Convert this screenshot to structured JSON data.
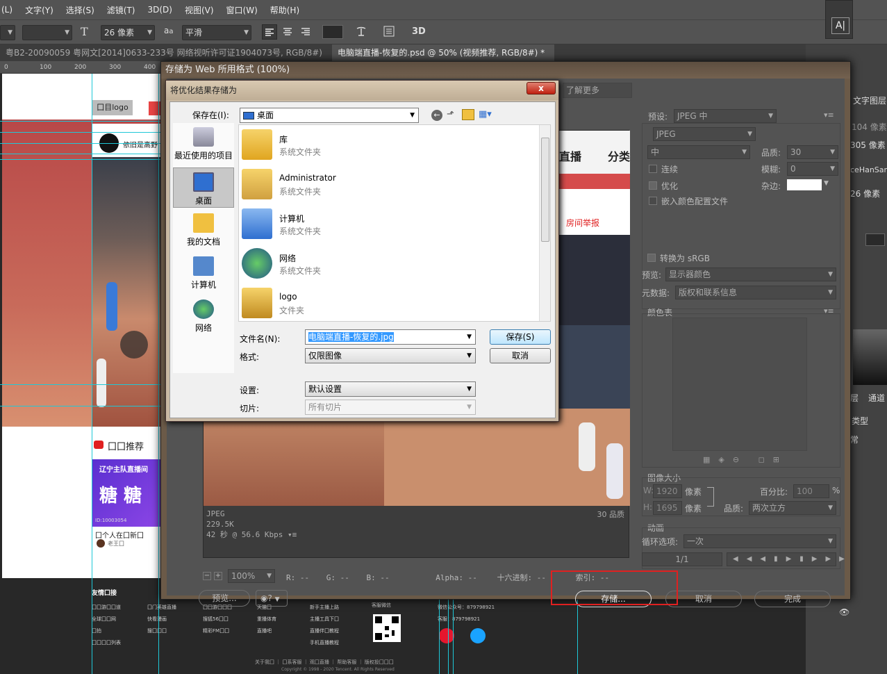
{
  "menubar": {
    "items": [
      "(L)",
      "文字(Y)",
      "选择(S)",
      "滤镜(T)",
      "3D(D)",
      "视图(V)",
      "窗口(W)",
      "帮助(H)"
    ]
  },
  "options": {
    "font_size": "26 像素",
    "aa_label": "a",
    "antialias": "平滑",
    "threed_label": "3D",
    "char_panel_label": "A|"
  },
  "tabs": [
    {
      "label": "粤B2-20090059 粤网文[2014]0633-233号 网络视听许可证1904073号, RGB/8#) *"
    },
    {
      "label": "电脑端直播-恢复的.psd @ 50% (视频推荐, RGB/8#) *"
    }
  ],
  "ruler": {
    "ticks": [
      "0",
      "100",
      "200",
      "300",
      "400"
    ]
  },
  "canvas": {
    "logo_text": "囗目logo",
    "anchor_name": "依旧是高野",
    "section_title": "囗囗推荐",
    "card_banner_line1": "辽宁主队直播间",
    "card_banner_line2": "糖 糖",
    "card_id": "ID:10003054",
    "card_title": "囗个人在囗新囗",
    "card_author": "老王囗",
    "preview_nav1": "直播",
    "preview_nav2": "分类",
    "preview_report": "房间举报",
    "footer_heading": "友情囗接",
    "footer_cols": [
      [
        "囗囗游囗囗道",
        "全球囗囗网",
        "囗拍",
        "囗囗囗囗列表"
      ],
      [
        "囗门英雄直播",
        "快看漫画",
        "搜囗囗囗"
      ],
      [
        "囗囗游囗囗囗",
        "搜狐56囗囗",
        "精彩FM囗囗"
      ],
      [
        "天猫囗",
        "重播体育",
        "直播吧"
      ],
      [
        "新手主播上路",
        "主播工具下囗",
        "直播伴囗教程",
        "手机直播教程"
      ],
      [
        "客服微信"
      ],
      [
        "微信公众号：879798921",
        "客服：879798921"
      ]
    ],
    "footer_links": "关于我囗 ｜ 囗系客服 ｜ 观囗直播 ｜ 帮助客服 ｜ 版权投囗囗囗",
    "footer_copyright": "Copyright © 1998 - 2020 Tencent. All Rights Reserved"
  },
  "sfw": {
    "title": "存储为 Web 所用格式 (100%)",
    "learn_more": "了解更多",
    "preset_label": "预设:",
    "preset_value": "JPEG 中",
    "format_value": "JPEG",
    "quality_preset": "中",
    "quality_label": "品质:",
    "quality_value": "30",
    "progressive_label": "连续",
    "blur_label": "模糊:",
    "blur_value": "0",
    "optimized_label": "优化",
    "matte_label": "杂边:",
    "embed_profile_label": "嵌入颜色配置文件",
    "convert_srgb_label": "转换为 sRGB",
    "preview_label": "预览:",
    "preview_value": "显示器颜色",
    "metadata_label": "元数据:",
    "metadata_value": "版权和联系信息",
    "color_table_label": "颜色表",
    "image_size_label": "图像大小",
    "w_label": "W:",
    "w_value": "1920",
    "h_label": "H:",
    "h_value": "1695",
    "px_label": "像素",
    "percent_label": "百分比:",
    "percent_value": "100",
    "percent_unit": "%",
    "resample_label": "品质:",
    "resample_value": "两次立方",
    "animation_label": "动画",
    "loop_label": "循环选项:",
    "loop_value": "一次",
    "frame_counter": "1/1",
    "preview_info_format": "JPEG",
    "preview_info_size": "229.5K",
    "preview_info_time": "42 秒 @ 56.6 Kbps",
    "preview_info_quality": "30 品质",
    "zoom_value": "100%",
    "r_label": "R:",
    "r_value": "--",
    "g_label": "G:",
    "g_value": "--",
    "b_label": "B:",
    "b_value": "--",
    "alpha_label": "Alpha:",
    "alpha_value": "--",
    "hex_label": "十六进制:",
    "hex_value": "--",
    "index_label": "索引:",
    "index_value": "--",
    "preview_button": "预览...",
    "save_button": "存储...",
    "cancel_button": "取消",
    "done_button": "完成"
  },
  "save_dialog": {
    "title": "将优化结果存储为",
    "close_label": "x",
    "save_in_label": "保存在(I):",
    "save_in_value": "桌面",
    "places": [
      "最近使用的项目",
      "桌面",
      "我的文档",
      "计算机",
      "网络"
    ],
    "files": [
      {
        "name": "库",
        "type": "系统文件夹"
      },
      {
        "name": "Administrator",
        "type": "系统文件夹"
      },
      {
        "name": "计算机",
        "type": "系统文件夹"
      },
      {
        "name": "网络",
        "type": "系统文件夹"
      },
      {
        "name": "logo",
        "type": "文件夹"
      }
    ],
    "filename_label": "文件名(N):",
    "filename_value": "电脑端直播-恢复的.jpg",
    "format_label": "格式:",
    "format_value": "仅限图像",
    "settings_label": "设置:",
    "settings_value": "默认设置",
    "slices_label": "切片:",
    "slices_value": "所有切片",
    "save_button": "保存(S)",
    "cancel_button": "取消"
  },
  "right_panel": {
    "text_layer_label": "文字图层",
    "size1": "104 像素",
    "size2": "305 像素",
    "font_fragment": "ceHanSans",
    "size3": "26 像素",
    "layers_tab": "层",
    "channels_tab": "通道",
    "kind_label": "类型",
    "blend_label": "常"
  },
  "colors": {
    "accent_red": "#e02020",
    "selection_blue": "#3399ff"
  }
}
